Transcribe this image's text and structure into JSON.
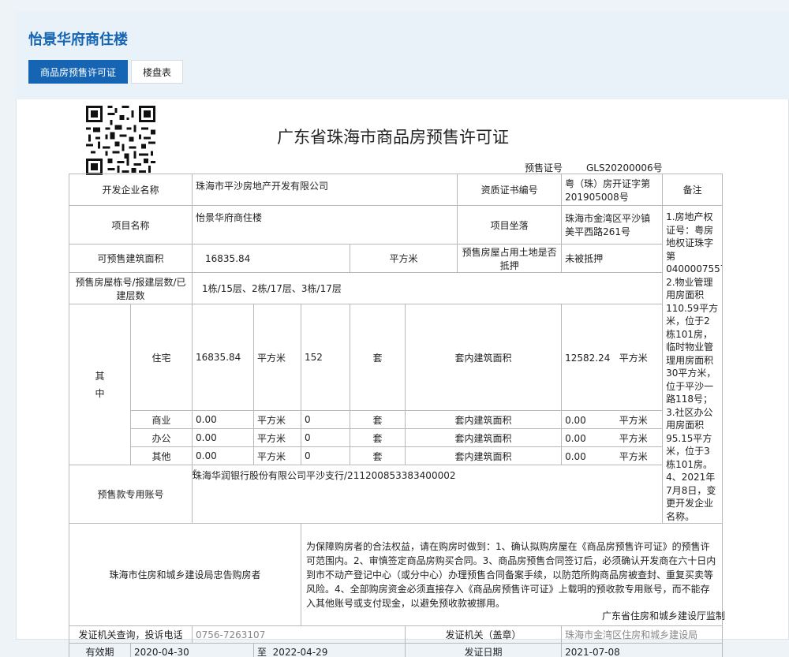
{
  "header": {
    "project_title": "怡景华府商住楼",
    "tabs": [
      {
        "label": "商品房预售许可证",
        "active": true
      },
      {
        "label": "楼盘表",
        "active": false
      }
    ]
  },
  "certificate": {
    "title": "广东省珠海市商品房预售许可证",
    "permit_no_label": "预售证号",
    "permit_no": "GLS20200006号",
    "qr_icon": "qr-code-icon",
    "developer_label": "开发企业名称",
    "developer": "珠海市平沙房地产开发有限公司",
    "qualification_label": "资质证书编号",
    "qualification": "粤（珠）房开证字第201905008号",
    "remark_label": "备注",
    "remark": "1.房地产权证号：粤房地权证珠字第0400007557； 2.物业管理用房面积110.59平方米，位于2栋101房，临时物业管理用房面积30平方米，位于平沙一路118号； 3.社区办公用房面积95.15平方米，位于3栋101房。 4、2021年7月8日，变更开发企业名称。",
    "project_label": "项目名称",
    "project": "怡景华府商住楼",
    "location_label": "项目坐落",
    "location": "珠海市金湾区平沙镇美平西路261号",
    "area_label": "可预售建筑面积",
    "area": "16835.84",
    "area_unit": "平方米",
    "land_mortgage_label": "预售房屋占用土地是否抵押",
    "land_mortgage": "未被抵押",
    "buildings_label": "预售房屋栋号/报建层数/已建层数",
    "buildings": "1栋/15层、2栋/17层、3栋/17层",
    "among_label": "其中",
    "uses": [
      {
        "type": "住宅",
        "area": "16835.84",
        "unit": "平方米",
        "count": "152",
        "count_unit": "套",
        "inner_label": "套内建筑面积",
        "inner_area": "12582.24",
        "inner_unit": "平方米"
      },
      {
        "type": "商业",
        "area": "0.00",
        "unit": "平方米",
        "count": "0",
        "count_unit": "套",
        "inner_label": "套内建筑面积",
        "inner_area": "0.00",
        "inner_unit": "平方米"
      },
      {
        "type": "办公",
        "area": "0.00",
        "unit": "平方米",
        "count": "0",
        "count_unit": "套",
        "inner_label": "套内建筑面积",
        "inner_area": "0.00",
        "inner_unit": "平方米"
      },
      {
        "type": "其他",
        "area": "0.00",
        "unit": "平方米",
        "count": "0",
        "count_unit": "套",
        "inner_label": "套内建筑面积",
        "inner_area": "0.00",
        "inner_unit": "平方米"
      }
    ],
    "account_label": "预售款专用账号",
    "account": "珠海华润银行股份有限公司平沙支行/211200853383400002",
    "notice_label": "珠海市住房和城乡建设局忠告购房者",
    "notice": "为保障购房者的合法权益，请在购房时做到：1、确认拟购房屋在《商品房预售许可证》的预售许可范围内。2、审慎签定商品房购买合同。3、商品房预售合同签订后，必须确认开发商在六十日内到市不动产登记中心（或分中心）办理预售合同备案手续，以防范所购商品房被查封、重复买卖等风险。4、全部购房资金必须直接存入《商品房预售许可证》上载明的预收款专用账号，而不能存入其他账号或支付现金，以避免预收款被挪用。",
    "complaint_label": "发证机关查询，投诉电话",
    "complaint_phone": "0756-7263107",
    "issuer_label": "发证机关（盖章）",
    "issuer": "珠海市金湾区住房和城乡建设局",
    "valid_label": "有效期",
    "valid_from": "2020-04-30",
    "valid_to_label": "至",
    "valid_to": "2022-04-29",
    "issue_date_label": "发证日期",
    "issue_date": "2021-07-08",
    "supervisor": "广东省住房和城乡建设厅监制"
  }
}
